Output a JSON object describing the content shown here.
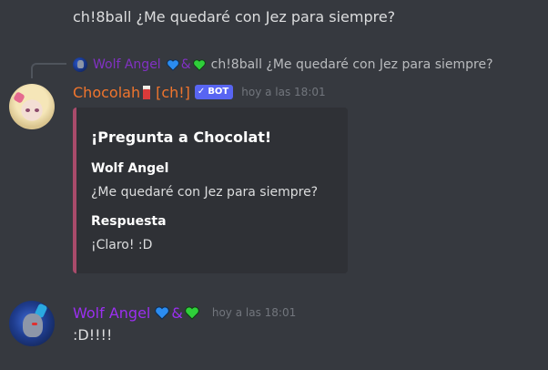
{
  "messages": {
    "first": {
      "text": "ch!8ball ¿Me quedaré con Jez para siempre?"
    },
    "reply": {
      "author": "Wolf Angel",
      "amp": "&",
      "text": "ch!8ball ¿Me quedaré con Jez para siempre?",
      "author_color": "#9b2ff0"
    },
    "bot": {
      "author": "Chocolah",
      "tag": "[ch!]",
      "badge": "BOT",
      "badge_check": "✓",
      "timestamp": "hoy a las 18:01",
      "author_color": "#f0752d",
      "embed": {
        "title": "¡Pregunta a Chocolat!",
        "accent_color": "#a94b6b",
        "fields": [
          {
            "name": "Wolf Angel",
            "value": "¿Me quedaré con Jez para siempre?"
          },
          {
            "name": "Respuesta",
            "value": "¡Claro! :D"
          }
        ]
      }
    },
    "user": {
      "author": "Wolf Angel",
      "amp": "&",
      "timestamp": "hoy a las 18:01",
      "text": ":D!!!!",
      "author_color": "#9b2ff0"
    }
  },
  "icons": {
    "blue_heart": "blue-heart-icon",
    "green_heart": "green-heart-icon",
    "drink": "chocolate-drink-icon"
  },
  "colors": {
    "background": "#36393f",
    "embed_background": "#2f3136",
    "blue_heart": "#2b8cf0",
    "green_heart": "#2fcf3a",
    "bot_badge": "#5865f2"
  }
}
